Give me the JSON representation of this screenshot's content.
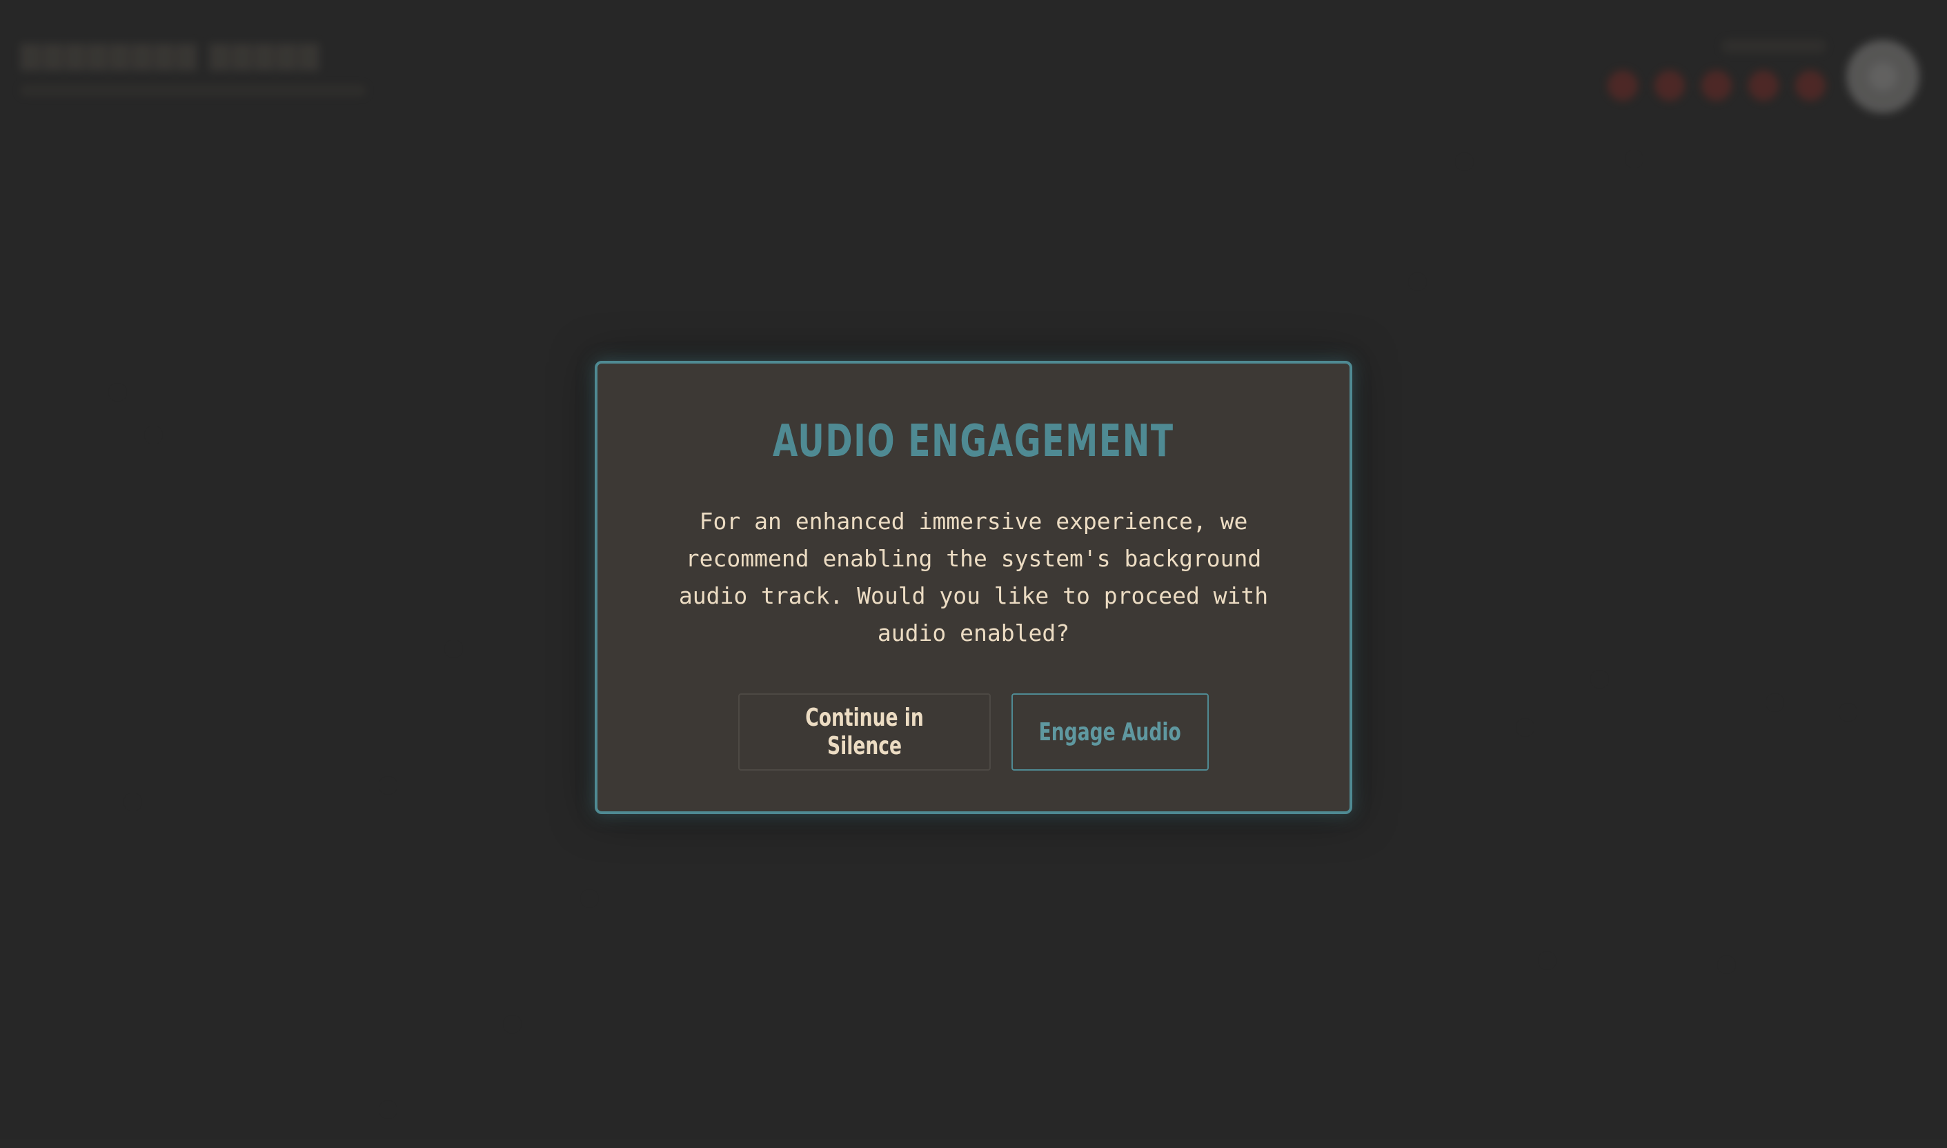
{
  "background": {
    "indicator_dots": [
      "red",
      "red",
      "red",
      "red",
      "red"
    ],
    "colors": {
      "page_bg": "#2a2a2a",
      "dot_red": "#7a2d28"
    }
  },
  "modal": {
    "title": "AUDIO ENGAGEMENT",
    "body": "For an enhanced immersive experience, we recommend enabling the system's background audio track. Would you like to proceed with audio enabled?",
    "buttons": {
      "silence": "Continue in Silence",
      "engage": "Engage Audio"
    },
    "colors": {
      "accent": "#4f8a93",
      "panel_bg": "#3d3935",
      "text": "#ecdcc3"
    }
  }
}
